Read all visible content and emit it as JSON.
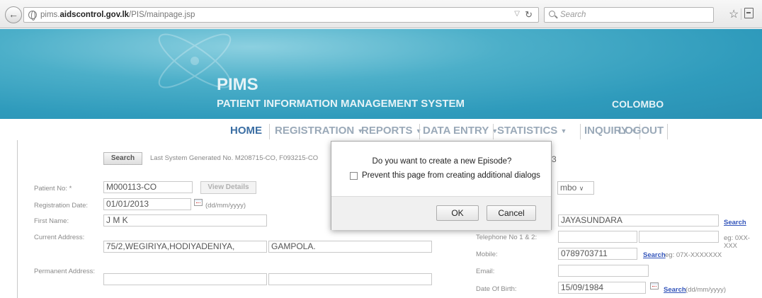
{
  "browser": {
    "url_prefix": "pims.",
    "url_domain": "aidscontrol.gov.lk",
    "url_path": "/PIS/mainpage.jsp",
    "search_placeholder": "Search"
  },
  "banner": {
    "title": "PIMS",
    "subtitle": "PATIENT INFORMATION MANAGEMENT SYSTEM",
    "location": "COLOMBO"
  },
  "nav": {
    "home": "HOME",
    "registration": "REGISTRATION",
    "reports": "REPORTS",
    "data_entry": "DATA ENTRY",
    "statistics": "STATISTICS",
    "inquiry": "INQUIRY",
    "logout": "LOGOUT",
    "caret": "▼"
  },
  "form": {
    "search_button": "Search",
    "last_system_generated": "Last System Generated No. M208715-CO, F093215-CO",
    "patient_no_label": "Patient No: *",
    "patient_no_value": "M000113-CO",
    "view_details_button": "View Details",
    "registration_date_label": "Registration Date:",
    "registration_date_value": "01/01/2013",
    "date_format_hint": "(dd/mm/yyyy)",
    "first_name_label": "First Name:",
    "first_name_value": "J M K",
    "current_address_label": "Current Address:",
    "current_address_line1": "75/2,WEGIRIYA,HODIYADENIYA,",
    "current_address_line2": "GAMPOLA.",
    "permanent_address_label": "Permanent Address:",
    "stray_number": "3",
    "clinic_select_value": "mbo",
    "last_name_value": "JAYASUNDARA",
    "last_name_search_link": "Search",
    "telephone_label": "Telephone No 1 & 2:",
    "telephone_hint": "eg: 0XX-XXX",
    "mobile_label": "Mobile:",
    "mobile_value": "0789703711",
    "mobile_search_link": "Search",
    "mobile_hint": "eg: 07X-XXXXXXX",
    "email_label": "Email:",
    "dob_label": "Date Of Birth:",
    "dob_value": "15/09/1984",
    "dob_search_link": "Search",
    "dob_hint": "(dd/mm/yyyy)"
  },
  "dialog": {
    "message": "Do you want to create a new Episode?",
    "checkbox_label": "Prevent this page from creating additional dialogs",
    "ok_label": "OK",
    "cancel_label": "Cancel"
  }
}
